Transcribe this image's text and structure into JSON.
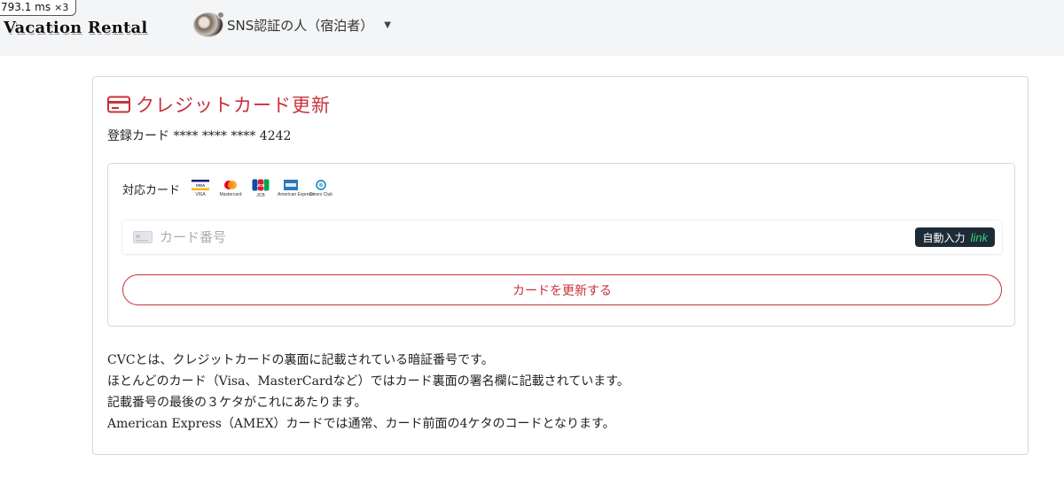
{
  "perf": {
    "time": "793.1 ms",
    "multiplier": "×3"
  },
  "header": {
    "logo": "Vacation Rental",
    "user_name": "SNS認証の人（宿泊者）"
  },
  "panel": {
    "title": "クレジットカード更新",
    "registered_card": "登録カード **** **** **** 4242",
    "supported_label": "対応カード",
    "brands": [
      {
        "name": "VISA",
        "color": "#1a1f71"
      },
      {
        "name": "Mastercard",
        "color": "#eb001b"
      },
      {
        "name": "JCB",
        "color": "#0b4ea2"
      },
      {
        "name": "American Express",
        "color": "#2e77bb"
      },
      {
        "name": "Diners Club",
        "color": "#0079be"
      }
    ],
    "card_input_placeholder": "カード番号",
    "autofill_label": "自動入力",
    "autofill_logo": "link",
    "update_button": "カードを更新する",
    "notes": [
      "CVCとは、クレジットカードの裏面に記載されている暗証番号です。",
      "ほとんどのカード（Visa、MasterCardなど）ではカード裏面の署名欄に記載されています。",
      "記載番号の最後の３ケタがこれにあたります。",
      "American Express（AMEX）カードでは通常、カード前面の4ケタのコードとなります。"
    ]
  },
  "colors": {
    "accent": "#c8313a",
    "topbar": "#f4f5f7",
    "link_green": "#33d47a"
  }
}
